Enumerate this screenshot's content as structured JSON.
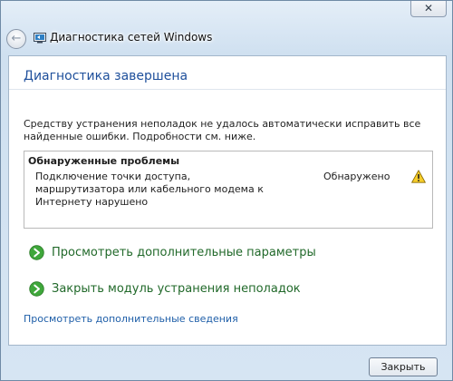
{
  "window": {
    "title": "Диагностика сетей Windows",
    "close_label": "✕"
  },
  "main": {
    "heading": "Диагностика завершена",
    "description": "Средству устранения неполадок не удалось автоматически исправить все найденные ошибки. Подробности см. ниже.",
    "problems": {
      "title": "Обнаруженные проблемы",
      "items": [
        {
          "text": "Подключение точки доступа, маршрутизатора или кабельного модема к Интернету нарушено",
          "status": "Обнаружено",
          "icon": "warning-icon"
        }
      ]
    },
    "actions": [
      {
        "label": "Просмотреть дополнительные параметры",
        "icon": "green-arrow-icon"
      },
      {
        "label": "Закрыть модуль устранения неполадок",
        "icon": "green-arrow-icon"
      }
    ],
    "details_link": "Просмотреть дополнительные сведения"
  },
  "footer": {
    "close_button": "Закрыть"
  },
  "colors": {
    "heading": "#1e4f9b",
    "action": "#21692a",
    "link": "#1e5ea8"
  }
}
